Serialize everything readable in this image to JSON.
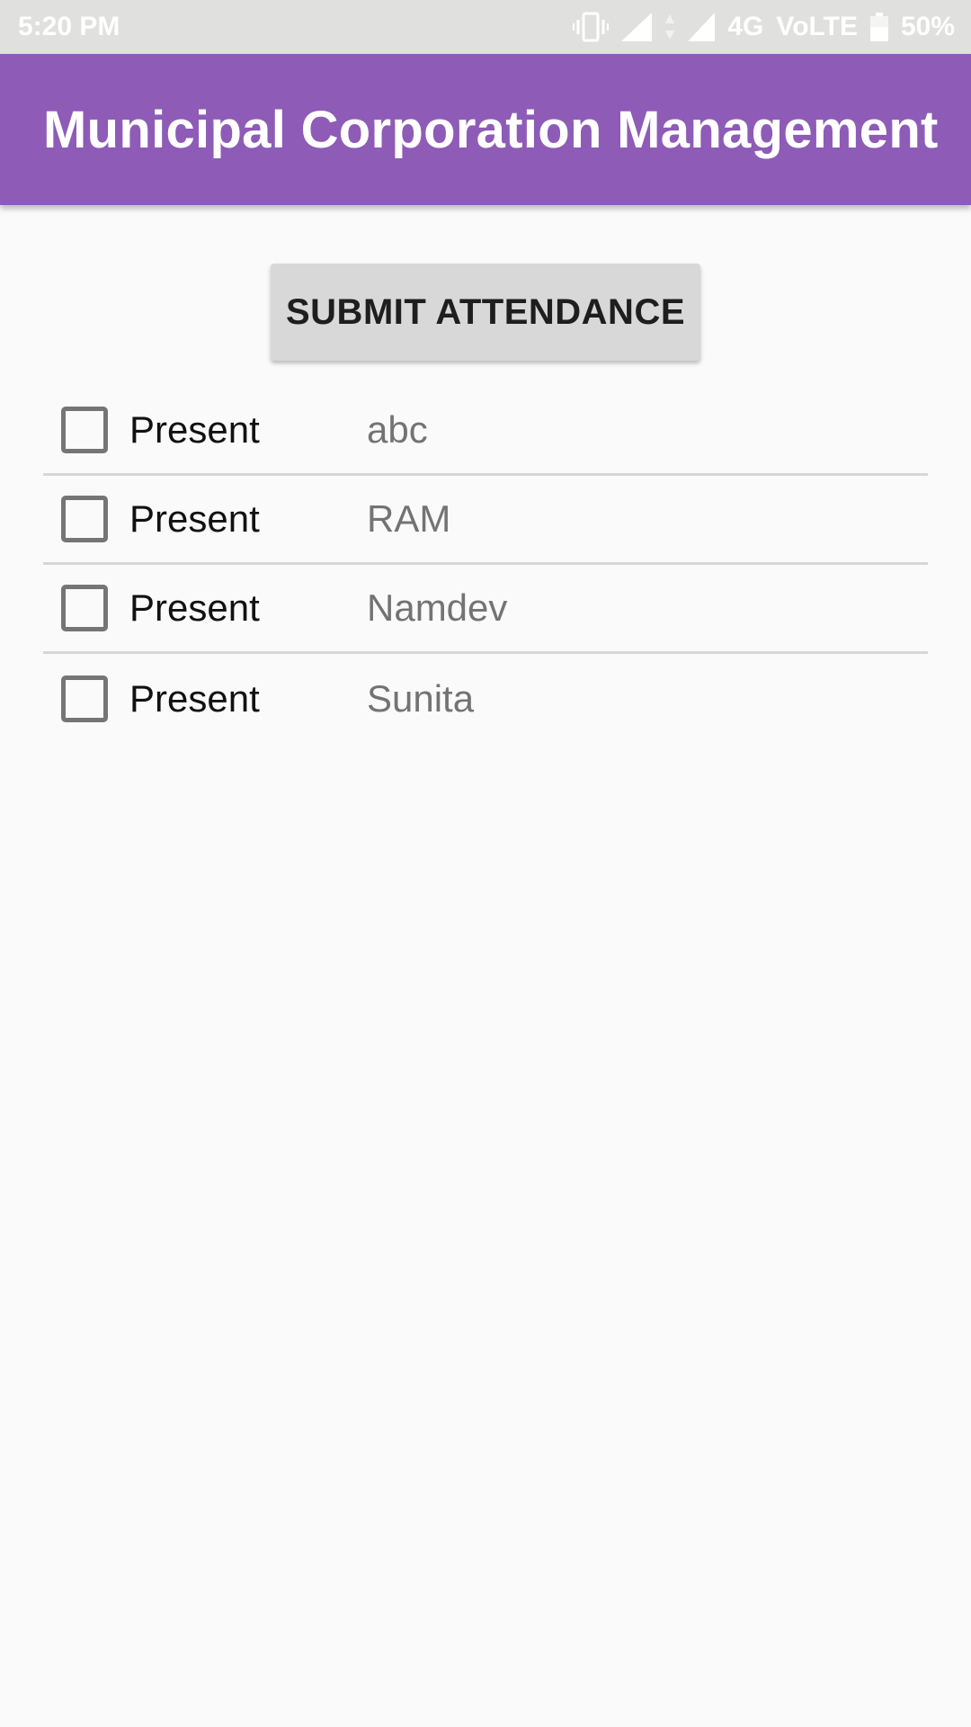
{
  "status_bar": {
    "time": "5:20 PM",
    "network": "4G",
    "volte": "VoLTE",
    "battery": "50%",
    "icons": [
      "vibrate-icon",
      "signal-icon",
      "data-arrows-icon",
      "signal-icon",
      "battery-icon"
    ]
  },
  "app_bar": {
    "title": "Municipal Corporation Management",
    "color": "#8e5bb7"
  },
  "actions": {
    "submit_label": "SUBMIT ATTENDANCE"
  },
  "attendance": {
    "rows": [
      {
        "checkbox_label": "Present",
        "name": "abc",
        "checked": false
      },
      {
        "checkbox_label": "Present",
        "name": "RAM",
        "checked": false
      },
      {
        "checkbox_label": "Present",
        "name": "Namdev",
        "checked": false
      },
      {
        "checkbox_label": "Present",
        "name": "Sunita",
        "checked": false
      }
    ]
  }
}
